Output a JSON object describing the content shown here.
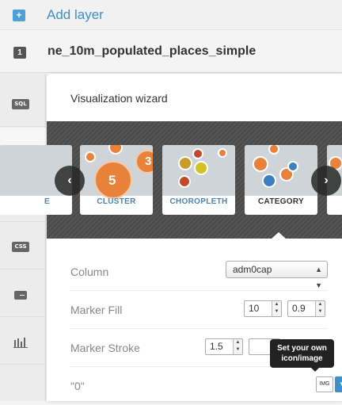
{
  "header": {
    "add_icon": "+",
    "add_label": "Add layer"
  },
  "layer": {
    "number": "1",
    "name": "ne_10m_populated_places_simple"
  },
  "sidebar": {
    "items": [
      {
        "label": "SQL",
        "icon": "sql-icon"
      },
      {
        "label": "",
        "icon": "brush-icon"
      },
      {
        "label": "",
        "icon": "comment-icon"
      },
      {
        "label": "CSS",
        "icon": "css-icon"
      },
      {
        "label": "",
        "icon": "legend-icon"
      },
      {
        "label": "",
        "icon": "bar-chart-icon"
      }
    ]
  },
  "wizard": {
    "title": "Visualization wizard",
    "types": [
      {
        "label": "E"
      },
      {
        "label": "CLUSTER",
        "number": "5",
        "number2": "3"
      },
      {
        "label": "CHOROPLETH"
      },
      {
        "label": "CATEGORY"
      }
    ],
    "selected": "CATEGORY",
    "prev": "‹",
    "next": "›"
  },
  "form": {
    "column": {
      "label": "Column",
      "value": "adm0cap"
    },
    "marker_fill": {
      "label": "Marker Fill",
      "width": "10",
      "opacity": "0.9"
    },
    "marker_stroke": {
      "label": "Marker Stroke",
      "width": "1.5"
    },
    "zero": {
      "label": "\"0\"",
      "img_label": "IMG"
    }
  },
  "tooltip": {
    "text": "Set your own icon/image"
  },
  "colors": {
    "accent": "#3d8fc9",
    "orange": "#e8823a",
    "blue": "#3b7ec4",
    "yellow": "#d4c12a",
    "red": "#c24a2a"
  }
}
